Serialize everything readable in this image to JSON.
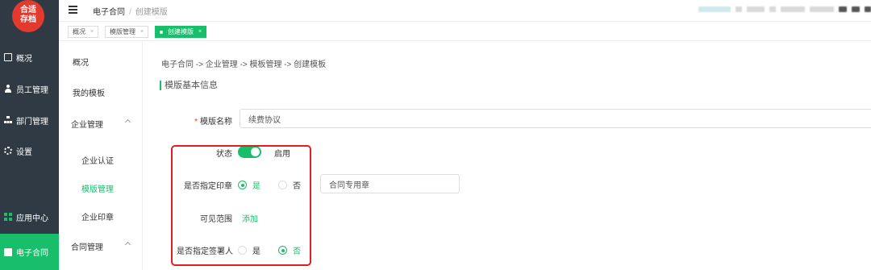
{
  "logo": {
    "line1": "合适",
    "line2": "存档"
  },
  "sidebar": {
    "items": [
      {
        "label": "概况",
        "icon": "chart-icon"
      },
      {
        "label": "员工管理",
        "icon": "user-icon"
      },
      {
        "label": "部门管理",
        "icon": "org-icon"
      },
      {
        "label": "设置",
        "icon": "gear-icon"
      },
      {
        "label": "应用中心",
        "icon": "grid-icon"
      },
      {
        "label": "电子合同",
        "icon": "doc-icon"
      }
    ]
  },
  "header": {
    "breadcrumb": {
      "root": "电子合同",
      "separator": "/",
      "current": "创建模版"
    }
  },
  "tabs": [
    {
      "label": "概况",
      "close": "×"
    },
    {
      "label": "模版管理",
      "close": "×"
    },
    {
      "label": "创建模版",
      "close": "×"
    }
  ],
  "submenu": {
    "overview": "概况",
    "my_templates": "我的模板",
    "enterprise": "企业管理",
    "enterprise_auth": "企业认证",
    "template_mgmt": "模版管理",
    "enterprise_seal": "企业印章",
    "contract_mgmt": "合同管理"
  },
  "main": {
    "path": "电子合同 -> 企业管理 -> 模板管理 -> 创建模板",
    "section_title": "模版基本信息",
    "name_label": "模版名称",
    "required_mark": "*",
    "name_value": "续费协议",
    "status_label": "状态",
    "status_value": "启用",
    "seal_label": "是否指定印章",
    "seal_yes": "是",
    "seal_no": "否",
    "seal_value": "合同专用章",
    "scope_label": "可见范围",
    "scope_add": "添加",
    "signer_label": "是否指定签署人",
    "signer_yes": "是",
    "signer_no": "否"
  },
  "colors": {
    "accent": "#19be6b",
    "sidebar": "#2f3a44",
    "highlight": "#e02020"
  }
}
